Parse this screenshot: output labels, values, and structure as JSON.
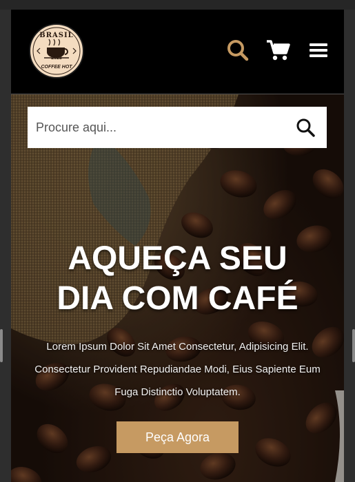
{
  "logo": {
    "brand_top": "BRASIL",
    "year": "2023",
    "brand_bottom": "COFFEE HOT"
  },
  "header": {
    "icons": [
      "search-icon",
      "cart-icon",
      "menu-icon"
    ],
    "accent_color": "#c69a62"
  },
  "search": {
    "placeholder": "Procure aqui...",
    "value": ""
  },
  "hero": {
    "headline_line1": "AQUEÇA SEU",
    "headline_line2": "DIA COM CAFÉ",
    "description": "Lorem Ipsum Dolor Sit Amet Consectetur, Adipisicing Elit. Consectetur Provident Repudiandae Modi, Eius Sapiente Eum Fuga Distinctio Voluptatem.",
    "cta_label": "Peça Agora",
    "cta_color": "#c69a62"
  }
}
